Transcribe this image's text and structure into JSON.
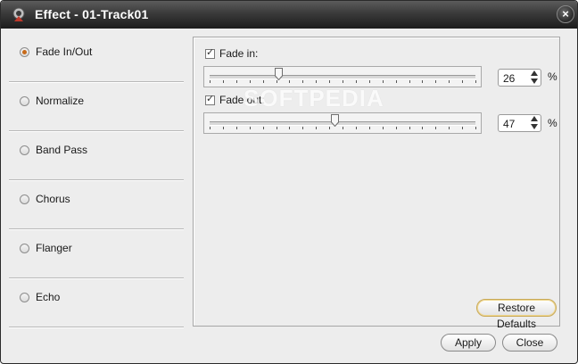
{
  "window": {
    "title": "Effect - 01-Track01",
    "close_glyph": "×",
    "app_icon": "speaker-icon"
  },
  "sidebar": {
    "items": [
      {
        "label": "Fade In/Out",
        "selected": true
      },
      {
        "label": "Normalize",
        "selected": false
      },
      {
        "label": "Band Pass",
        "selected": false
      },
      {
        "label": "Chorus",
        "selected": false
      },
      {
        "label": "Flanger",
        "selected": false
      },
      {
        "label": "Echo",
        "selected": false
      }
    ]
  },
  "fade": {
    "fade_in": {
      "label": "Fade in:",
      "checked": true,
      "value": "26",
      "unit": "%",
      "level": 0.26
    },
    "fade_out": {
      "label": "Fade out:",
      "checked": true,
      "value": "47",
      "unit": "%",
      "level": 0.47
    },
    "check_glyph": "✓",
    "restore_label": "Restore Defaults"
  },
  "watermark": "SOFTPEDIA",
  "footer": {
    "apply_label": "Apply",
    "close_label": "Close"
  },
  "colors": {
    "radio_selected": "#c76a1a",
    "titlebar": "#2a2a2a",
    "focus_border": "#c8a95a"
  }
}
